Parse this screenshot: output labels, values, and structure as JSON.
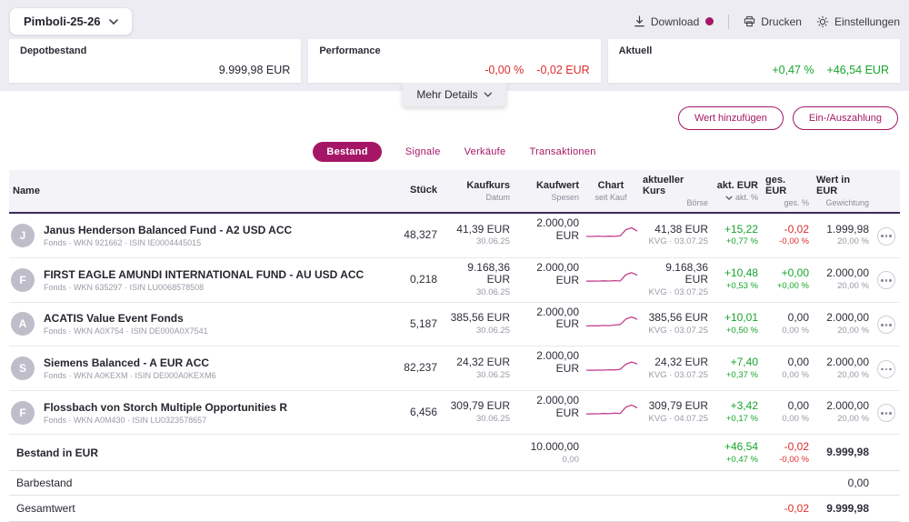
{
  "colors": {
    "accent": "#a51766",
    "green": "#17a52c",
    "red": "#dd2c2c",
    "spark": "#c2418f"
  },
  "header": {
    "portfolio_name": "Pimboli-25-26",
    "download_label": "Download",
    "print_label": "Drucken",
    "settings_label": "Einstellungen"
  },
  "icons": {
    "portfolio_chevron": "chevron-down",
    "download": "download-arrow",
    "download_badge": "magenta-dot",
    "print": "printer",
    "settings": "gear",
    "mehr_details_chevron": "chevron-down",
    "sort": "chevron-down",
    "row_menu": "ellipsis-circle"
  },
  "cards": {
    "depotbestand": {
      "label": "Depotbestand",
      "value": "9.999,98 EUR"
    },
    "performance": {
      "label": "Performance",
      "pct": "-0,00 %",
      "amount": "-0,02 EUR"
    },
    "aktuell": {
      "label": "Aktuell",
      "pct": "+0,47 %",
      "amount": "+46,54 EUR"
    }
  },
  "mehr_details_label": "Mehr Details",
  "actions": {
    "add_value": "Wert hinzufügen",
    "deposit": "Ein-/Auszahlung"
  },
  "tabs": [
    {
      "label": "Bestand",
      "active": true
    },
    {
      "label": "Signale",
      "active": false
    },
    {
      "label": "Verkäufe",
      "active": false
    },
    {
      "label": "Transaktionen",
      "active": false
    }
  ],
  "table": {
    "columns": [
      {
        "main": "Name",
        "sub": ""
      },
      {
        "main": "Stück",
        "sub": ""
      },
      {
        "main": "Kaufkurs",
        "sub": "Datum"
      },
      {
        "main": "Kaufwert",
        "sub": "Spesen"
      },
      {
        "main": "Chart",
        "sub": "seit Kauf"
      },
      {
        "main": "aktueller Kurs",
        "sub": "Börse"
      },
      {
        "main": "akt. EUR",
        "sub": "akt. %"
      },
      {
        "main": "ges. EUR",
        "sub": "ges. %"
      },
      {
        "main": "Wert in EUR",
        "sub": "Gewichtung"
      }
    ],
    "rows": [
      {
        "initial": "J",
        "name": "Janus Henderson Balanced Fund - A2 USD ACC",
        "details": "Fonds · WKN 921662 · ISIN IE0004445015",
        "stueck": "48,327",
        "kaufkurs": "41,39 EUR",
        "kaufdatum": "30.06.25",
        "kaufwert": "2.000,00 EUR",
        "spesen": "",
        "spark": [
          13,
          13,
          12.6,
          13,
          12.7,
          12.9,
          12.3,
          5.5,
          3.5,
          7
        ],
        "kurs": "41,38 EUR",
        "boerse": "KVG · 03.07.25",
        "akt_eur": "+15,22",
        "akt_pct": "+0,77 %",
        "ges_eur": "-0,02",
        "ges_pct": "-0,00 %",
        "wert": "1.999,98",
        "gewichtung": "20,00 %"
      },
      {
        "initial": "F",
        "name": "FIRST EAGLE AMUNDI INTERNATIONAL FUND - AU USD ACC",
        "details": "Fonds · WKN 635297 · ISIN LU0068578508",
        "stueck": "0,218",
        "kaufkurs": "9.168,36 EUR",
        "kaufdatum": "30.06.25",
        "kaufwert": "2.000,00 EUR",
        "spesen": "",
        "spark": [
          13.2,
          13,
          13.1,
          12.8,
          13,
          12.6,
          12.9,
          6,
          3.8,
          6.5
        ],
        "kurs": "9.168,36 EUR",
        "boerse": "KVG · 03.07.25",
        "akt_eur": "+10,48",
        "akt_pct": "+0,53 %",
        "ges_eur": "+0,00",
        "ges_pct": "+0,00 %",
        "wert": "2.000,00",
        "gewichtung": "20,00 %"
      },
      {
        "initial": "A",
        "name": "ACATIS Value Event Fonds",
        "details": "Fonds · WKN A0X754 · ISIN DE000A0X7541",
        "stueck": "5,187",
        "kaufkurs": "385,56 EUR",
        "kaufdatum": "30.06.25",
        "kaufwert": "2.000,00 EUR",
        "spesen": "",
        "spark": [
          13.5,
          13.1,
          13.3,
          12.9,
          13.1,
          12.4,
          11.8,
          5.8,
          3.6,
          6
        ],
        "kurs": "385,56 EUR",
        "boerse": "KVG · 03.07.25",
        "akt_eur": "+10,01",
        "akt_pct": "+0,50 %",
        "ges_eur": "0,00",
        "ges_pct": "0,00 %",
        "wert": "2.000,00",
        "gewichtung": "20,00 %"
      },
      {
        "initial": "S",
        "name": "Siemens Balanced - A EUR ACC",
        "details": "Fonds · WKN A0KEXM · ISIN DE000A0KEXM6",
        "stueck": "82,237",
        "kaufkurs": "24,32 EUR",
        "kaufdatum": "30.06.25",
        "kaufwert": "2.000,00 EUR",
        "spesen": "",
        "spark": [
          13,
          13.2,
          12.9,
          13,
          12.6,
          12.8,
          12.1,
          6.5,
          4,
          6.2
        ],
        "kurs": "24,32 EUR",
        "boerse": "KVG · 03.07.25",
        "akt_eur": "+7,40",
        "akt_pct": "+0,37 %",
        "ges_eur": "0,00",
        "ges_pct": "0,00 %",
        "wert": "2.000,00",
        "gewichtung": "20,00 %"
      },
      {
        "initial": "F",
        "name": "Flossbach von Storch Multiple Opportunities R",
        "details": "Fonds · WKN A0M430 · ISIN LU0323578657",
        "stueck": "6,456",
        "kaufkurs": "309,79 EUR",
        "kaufdatum": "30.06.25",
        "kaufwert": "2.000,00 EUR",
        "spesen": "",
        "spark": [
          13.3,
          13,
          13.1,
          12.7,
          12.9,
          12.3,
          12.6,
          5.6,
          3.4,
          6.4
        ],
        "kurs": "309,79 EUR",
        "boerse": "KVG · 04.07.25",
        "akt_eur": "+3,42",
        "akt_pct": "+0,17 %",
        "ges_eur": "0,00",
        "ges_pct": "0,00 %",
        "wert": "2.000,00",
        "gewichtung": "20,00 %"
      }
    ],
    "totals": {
      "bestand": {
        "label": "Bestand in EUR",
        "kaufwert": "10.000,00",
        "spesen": "0,00",
        "akt_eur": "+46,54",
        "akt_pct": "+0,47 %",
        "ges_eur": "-0,02",
        "ges_pct": "-0,00 %",
        "wert": "9.999,98"
      },
      "barbestand": {
        "label": "Barbestand",
        "wert": "0,00"
      },
      "gesamtwert": {
        "label": "Gesamtwert",
        "ges_eur": "-0,02",
        "wert": "9.999,98"
      }
    }
  }
}
